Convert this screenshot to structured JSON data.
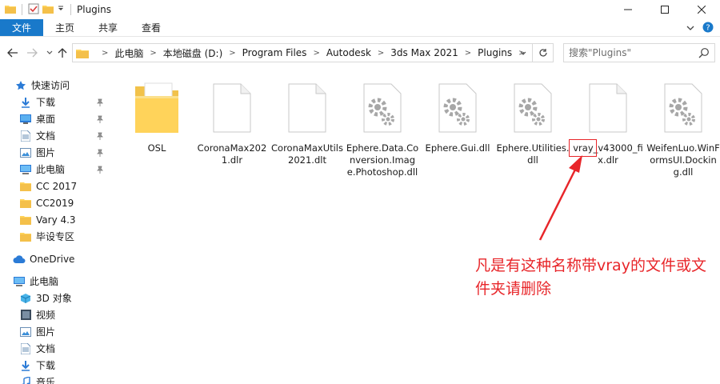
{
  "window": {
    "title": "Plugins",
    "controls": {
      "minimize": "—",
      "maximize": "☐",
      "close": "✕"
    }
  },
  "ribbon": {
    "tabs": [
      {
        "label": "文件",
        "active": true
      },
      {
        "label": "主页"
      },
      {
        "label": "共享"
      },
      {
        "label": "查看"
      }
    ]
  },
  "address": {
    "breadcrumbs": [
      "此电脑",
      "本地磁盘 (D:)",
      "Program Files",
      "Autodesk",
      "3ds Max 2021",
      "Plugins"
    ],
    "search_placeholder": "搜索\"Plugins\""
  },
  "sidebar": {
    "quick_access": {
      "label": "快速访问"
    },
    "quick_items": [
      {
        "label": "下载",
        "icon": "download-icon",
        "pinned": true
      },
      {
        "label": "桌面",
        "icon": "desktop-icon",
        "pinned": true
      },
      {
        "label": "文档",
        "icon": "document-icon",
        "pinned": true
      },
      {
        "label": "图片",
        "icon": "picture-icon",
        "pinned": true
      },
      {
        "label": "此电脑",
        "icon": "computer-icon",
        "pinned": true
      },
      {
        "label": "CC 2017",
        "icon": "folder-icon"
      },
      {
        "label": "CC2019",
        "icon": "folder-icon"
      },
      {
        "label": "Vary 4.3",
        "icon": "folder-icon"
      },
      {
        "label": "毕设专区",
        "icon": "folder-icon"
      }
    ],
    "onedrive": {
      "label": "OneDrive"
    },
    "this_pc": {
      "label": "此电脑"
    },
    "pc_items": [
      {
        "label": "3D 对象",
        "icon": "3d-objects-icon"
      },
      {
        "label": "视频",
        "icon": "video-icon"
      },
      {
        "label": "图片",
        "icon": "picture-icon"
      },
      {
        "label": "文档",
        "icon": "document-icon"
      },
      {
        "label": "下载",
        "icon": "download-icon"
      },
      {
        "label": "音乐",
        "icon": "music-icon"
      }
    ]
  },
  "files": [
    {
      "name": "OSL",
      "type": "folder"
    },
    {
      "name": "CoronaMax2021.dlr",
      "type": "blank"
    },
    {
      "name": "CoronaMaxUtils2021.dlt",
      "type": "blank"
    },
    {
      "name": "Ephere.Data.Conversion.Image.Photoshop.dll",
      "type": "gear"
    },
    {
      "name": "Ephere.Gui.dll",
      "type": "gear"
    },
    {
      "name": "Ephere.Utilities.dll",
      "type": "gear"
    },
    {
      "name": "vray_v43000_fix.dlr",
      "type": "blank"
    },
    {
      "name": "WeifenLuo.WinFormsUI.Docking.dll",
      "type": "gear"
    }
  ],
  "annotation": {
    "text": "凡是有这种名称带vray的文件或文件夹请删除",
    "color": "#e8262a"
  },
  "colors": {
    "accent": "#1979ca",
    "folder": "#ffd35a",
    "annotation": "#e8262a"
  }
}
